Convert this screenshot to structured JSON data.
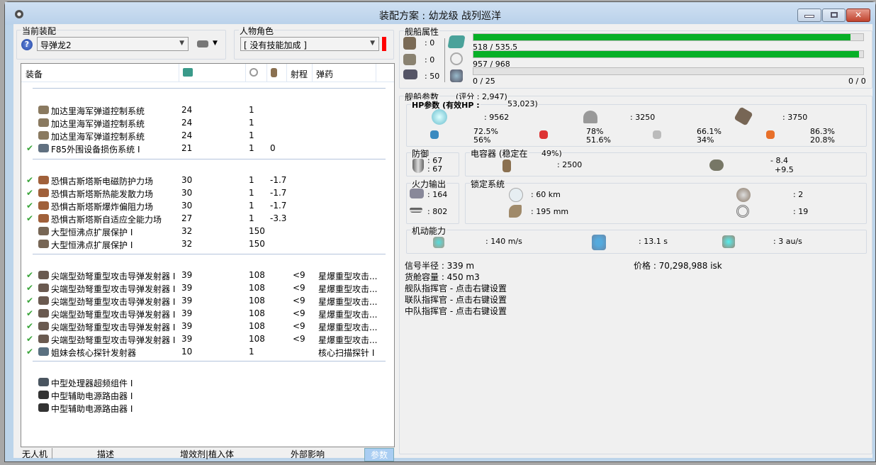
{
  "window": {
    "title": "装配方案 : 幼龙级 战列巡洋",
    "minimize_icon": "minimize",
    "maximize_icon": "maximize",
    "close_icon": "close",
    "close_glyph": "✕"
  },
  "fitting": {
    "label": "当前装配",
    "value": "导弹龙2",
    "help_icon": "question-icon"
  },
  "character": {
    "label": "人物角色",
    "value": "[ 没有技能加成 ]",
    "status_color": "#ff0000"
  },
  "list": {
    "headers": {
      "name": "装备",
      "range": "射程",
      "ammo": "弹药"
    },
    "groups": [
      [
        {
          "checked": false,
          "name": "加达里海军弹道控制系统",
          "cpu": "24",
          "pg": "1",
          "cap": "",
          "range": "",
          "ammo": "",
          "icon": "#8a7a60"
        },
        {
          "checked": false,
          "name": "加达里海军弹道控制系统",
          "cpu": "24",
          "pg": "1",
          "cap": "",
          "range": "",
          "ammo": "",
          "icon": "#8a7a60"
        },
        {
          "checked": false,
          "name": "加达里海军弹道控制系统",
          "cpu": "24",
          "pg": "1",
          "cap": "",
          "range": "",
          "ammo": "",
          "icon": "#8a7a60"
        },
        {
          "checked": true,
          "name": "F85外围设备损伤系统 I",
          "cpu": "21",
          "pg": "1",
          "cap": "0",
          "range": "",
          "ammo": "",
          "icon": "#607080"
        }
      ],
      [
        {
          "checked": true,
          "name": "恐惧古斯塔斯电磁防护力场",
          "cpu": "30",
          "pg": "1",
          "cap": "-1.7",
          "range": "",
          "ammo": "",
          "icon": "#a0603a"
        },
        {
          "checked": true,
          "name": "恐惧古斯塔斯热能发散力场",
          "cpu": "30",
          "pg": "1",
          "cap": "-1.7",
          "range": "",
          "ammo": "",
          "icon": "#a0603a"
        },
        {
          "checked": true,
          "name": "恐惧古斯塔斯爆炸偏阻力场",
          "cpu": "30",
          "pg": "1",
          "cap": "-1.7",
          "range": "",
          "ammo": "",
          "icon": "#a0603a"
        },
        {
          "checked": true,
          "name": "恐惧古斯塔斯自适应全能力场",
          "cpu": "27",
          "pg": "1",
          "cap": "-3.3",
          "range": "",
          "ammo": "",
          "icon": "#a0603a"
        },
        {
          "checked": false,
          "name": "大型恒沸点扩展保护 I",
          "cpu": "32",
          "pg": "150",
          "cap": "",
          "range": "",
          "ammo": "",
          "icon": "#776655"
        },
        {
          "checked": false,
          "name": "大型恒沸点扩展保护 I",
          "cpu": "32",
          "pg": "150",
          "cap": "",
          "range": "",
          "ammo": "",
          "icon": "#776655"
        }
      ],
      [
        {
          "checked": true,
          "name": "尖端型劲弩重型攻击导弹发射器 I",
          "cpu": "39",
          "pg": "108",
          "cap": "",
          "range": "<9",
          "ammo": "星爆重型攻击...",
          "icon": "#6a5a50"
        },
        {
          "checked": true,
          "name": "尖端型劲弩重型攻击导弹发射器 I",
          "cpu": "39",
          "pg": "108",
          "cap": "",
          "range": "<9",
          "ammo": "星爆重型攻击...",
          "icon": "#6a5a50"
        },
        {
          "checked": true,
          "name": "尖端型劲弩重型攻击导弹发射器 I",
          "cpu": "39",
          "pg": "108",
          "cap": "",
          "range": "<9",
          "ammo": "星爆重型攻击...",
          "icon": "#6a5a50"
        },
        {
          "checked": true,
          "name": "尖端型劲弩重型攻击导弹发射器 I",
          "cpu": "39",
          "pg": "108",
          "cap": "",
          "range": "<9",
          "ammo": "星爆重型攻击...",
          "icon": "#6a5a50"
        },
        {
          "checked": true,
          "name": "尖端型劲弩重型攻击导弹发射器 I",
          "cpu": "39",
          "pg": "108",
          "cap": "",
          "range": "<9",
          "ammo": "星爆重型攻击...",
          "icon": "#6a5a50"
        },
        {
          "checked": true,
          "name": "尖端型劲弩重型攻击导弹发射器 I",
          "cpu": "39",
          "pg": "108",
          "cap": "",
          "range": "<9",
          "ammo": "星爆重型攻击...",
          "icon": "#6a5a50"
        },
        {
          "checked": true,
          "name": "姐妹会核心探针发射器",
          "cpu": "10",
          "pg": "1",
          "cap": "",
          "range": "",
          "ammo": "核心扫描探针 I",
          "icon": "#5a7080"
        }
      ],
      [
        {
          "checked": false,
          "name": "中型处理器超频组件 I",
          "cpu": "",
          "pg": "",
          "cap": "",
          "range": "",
          "ammo": "",
          "icon": "#4a5560"
        },
        {
          "checked": false,
          "name": "中型辅助电源路由器 I",
          "cpu": "",
          "pg": "",
          "cap": "",
          "range": "",
          "ammo": "",
          "icon": "#333333"
        },
        {
          "checked": false,
          "name": "中型辅助电源路由器 I",
          "cpu": "",
          "pg": "",
          "cap": "",
          "range": "",
          "ammo": "",
          "icon": "#333333"
        }
      ]
    ]
  },
  "tabs": [
    "无人机",
    "描述",
    "增效剂|植入体",
    "外部影响",
    "参数"
  ],
  "ship_attrs": {
    "label": "舰船属性",
    "turret": ": 0",
    "launcher": ": 0",
    "calibration": ": 50",
    "cpu": {
      "text": "518 / 535.5",
      "fraction": 0.967
    },
    "powergrid": {
      "text": "957 / 968",
      "fraction": 0.989
    },
    "drone_bay": {
      "text": "0 / 25",
      "fraction": 0
    },
    "drone_bw": "0 / 0"
  },
  "ship_params": {
    "label": "舰船参数",
    "score": "(评分 : 2,947)",
    "hp_label": "HP参数 (有效HP :",
    "ehp": "53,023)",
    "shield": ": 9562",
    "armor": ": 3250",
    "hull": ": 3750",
    "resists": [
      [
        "72.5%",
        "56%"
      ],
      [
        "78%",
        "51.6%"
      ],
      [
        "66.1%",
        "34%"
      ],
      [
        "86.3%",
        "20.8%"
      ]
    ],
    "defense_label": "防御",
    "defense": [
      ": 67",
      ": 67"
    ],
    "cap_label": "电容器 (稳定在",
    "cap_stable": "49%)",
    "cap_amount": ": 2500",
    "cap_delta": [
      "- 8.4",
      "+9.5"
    ],
    "fire_label": "火力输出",
    "fire": [
      ": 164",
      ": 802"
    ],
    "lock_label": "锁定系统",
    "lock_range": ": 60 km",
    "scan_res": ": 195 mm",
    "max_targets": ": 2",
    "sensor": ": 19",
    "move_label": "机动能力",
    "speed": ": 140 m/s",
    "align": ": 13.1 s",
    "warp": ": 3 au/s",
    "sig": "信号半径 : 339 m",
    "price": "价格 : 70,298,988 isk",
    "cargo": "货舱容量 : 450 m3",
    "boosters": [
      "舰队指挥官 - 点击右键设置",
      "联队指挥官 - 点击右键设置",
      "中队指挥官 - 点击右键设置"
    ]
  }
}
